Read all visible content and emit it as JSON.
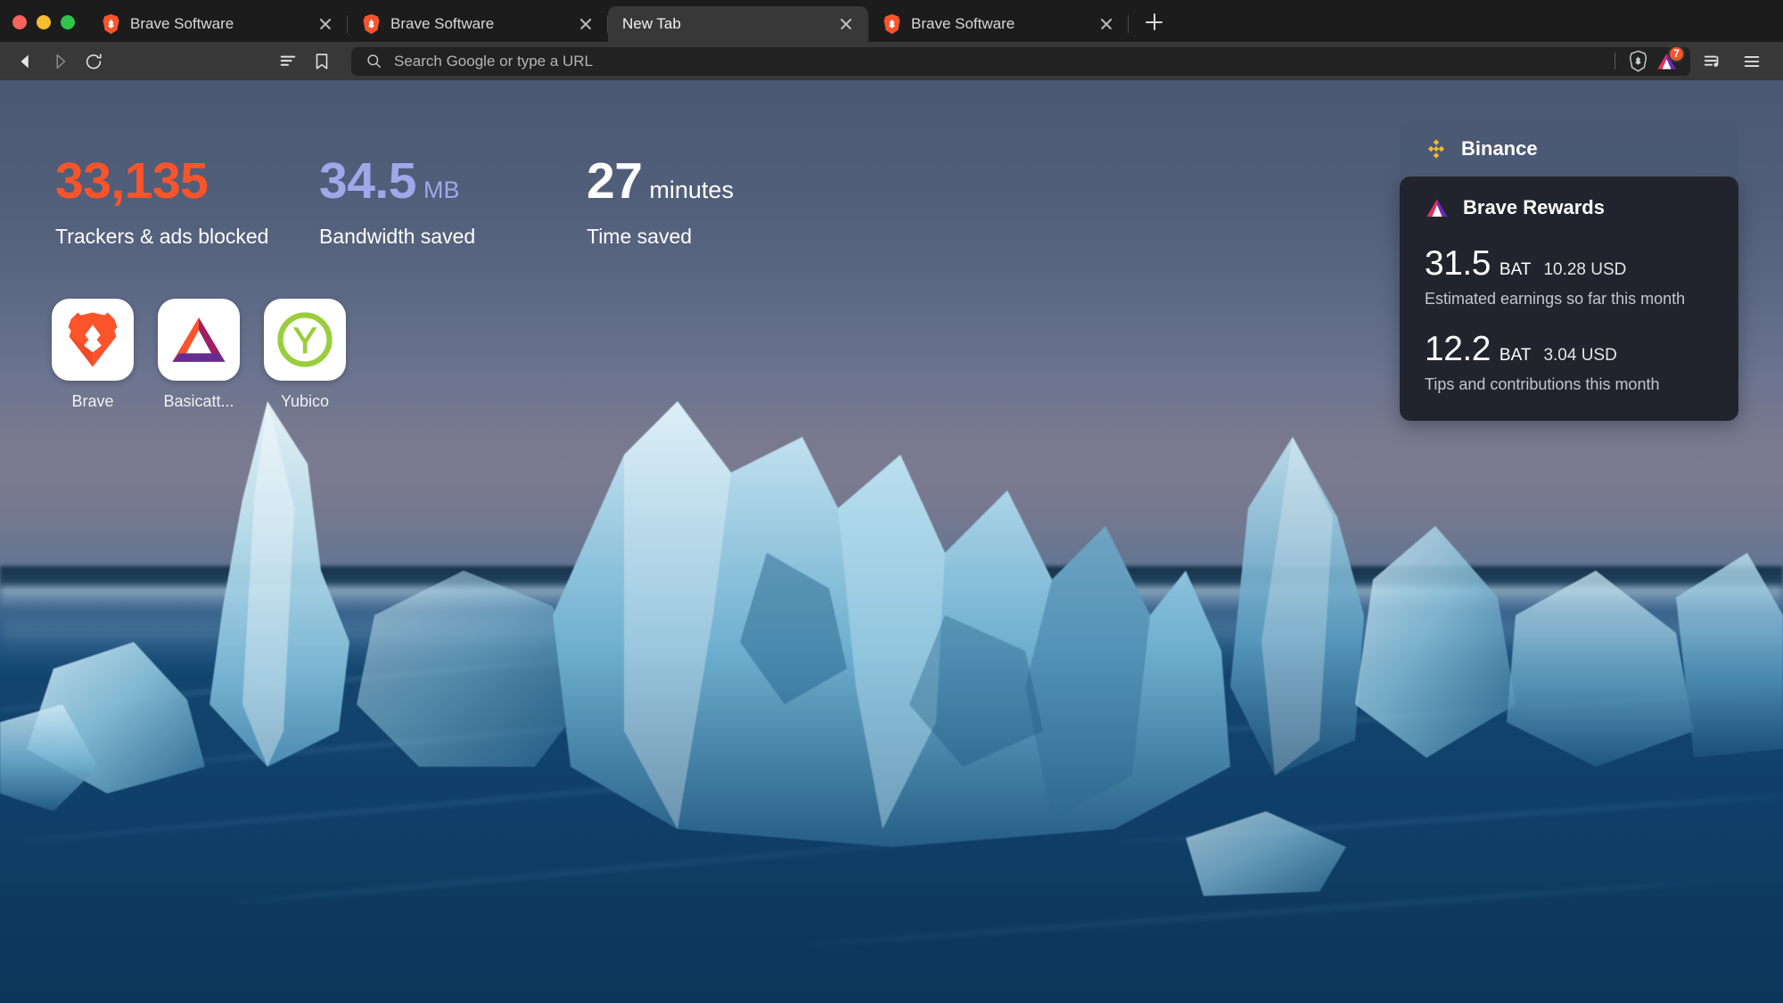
{
  "window": {
    "traffic_lights": [
      "close",
      "minimize",
      "maximize"
    ],
    "colors": {
      "close": "#f4635c",
      "minimize": "#f5bd31",
      "maximize": "#2fc44a"
    }
  },
  "tabs": [
    {
      "title": "Brave Software",
      "favicon": "brave-lion-icon",
      "active": false
    },
    {
      "title": "Brave Software",
      "favicon": "brave-lion-icon",
      "active": false
    },
    {
      "title": "New Tab",
      "favicon": null,
      "active": true
    },
    {
      "title": "Brave Software",
      "favicon": "brave-lion-icon",
      "active": false
    }
  ],
  "toolbar": {
    "back": "back-icon",
    "forward": "forward-icon",
    "reload": "reload-icon",
    "reading_list": "reading-list-icon",
    "bookmark": "bookmark-icon",
    "search_icon": "search-icon",
    "omnibox_value": "",
    "omnibox_placeholder": "Search Google or type a URL",
    "shields_icon": "brave-shields-lion-icon",
    "rewards_icon": "brave-rewards-triangle-icon",
    "rewards_badge_count": "7",
    "rewards_badge_color": "#fb542b",
    "playlist": "playlist-icon",
    "menu": "hamburger-menu-icon"
  },
  "stats": [
    {
      "value": "33,135",
      "unit": "",
      "caption": "Trackers & ads blocked",
      "color": "#fb542b"
    },
    {
      "value": "34.5",
      "unit": "MB",
      "caption": "Bandwidth saved",
      "color": "#a0a8ea"
    },
    {
      "value": "27",
      "unit": "minutes",
      "caption": "Time saved",
      "color": "#ffffff"
    }
  ],
  "shortcuts": [
    {
      "label": "Brave",
      "icon": "brave-lion-icon"
    },
    {
      "label": "Basicatt...",
      "icon": "basic-attention-token-icon"
    },
    {
      "label": "Yubico",
      "icon": "yubico-y-icon"
    }
  ],
  "widget": {
    "tab_label": "Binance",
    "tab_icon": "binance-icon",
    "card_title": "Brave Rewards",
    "card_icon": "brave-rewards-triangle-icon",
    "rows": [
      {
        "amount": "31.5",
        "currency": "BAT",
        "fiat": "10.28 USD",
        "description": "Estimated earnings so far this month"
      },
      {
        "amount": "12.2",
        "currency": "BAT",
        "fiat": "3.04 USD",
        "description": "Tips and contributions this month"
      }
    ]
  }
}
